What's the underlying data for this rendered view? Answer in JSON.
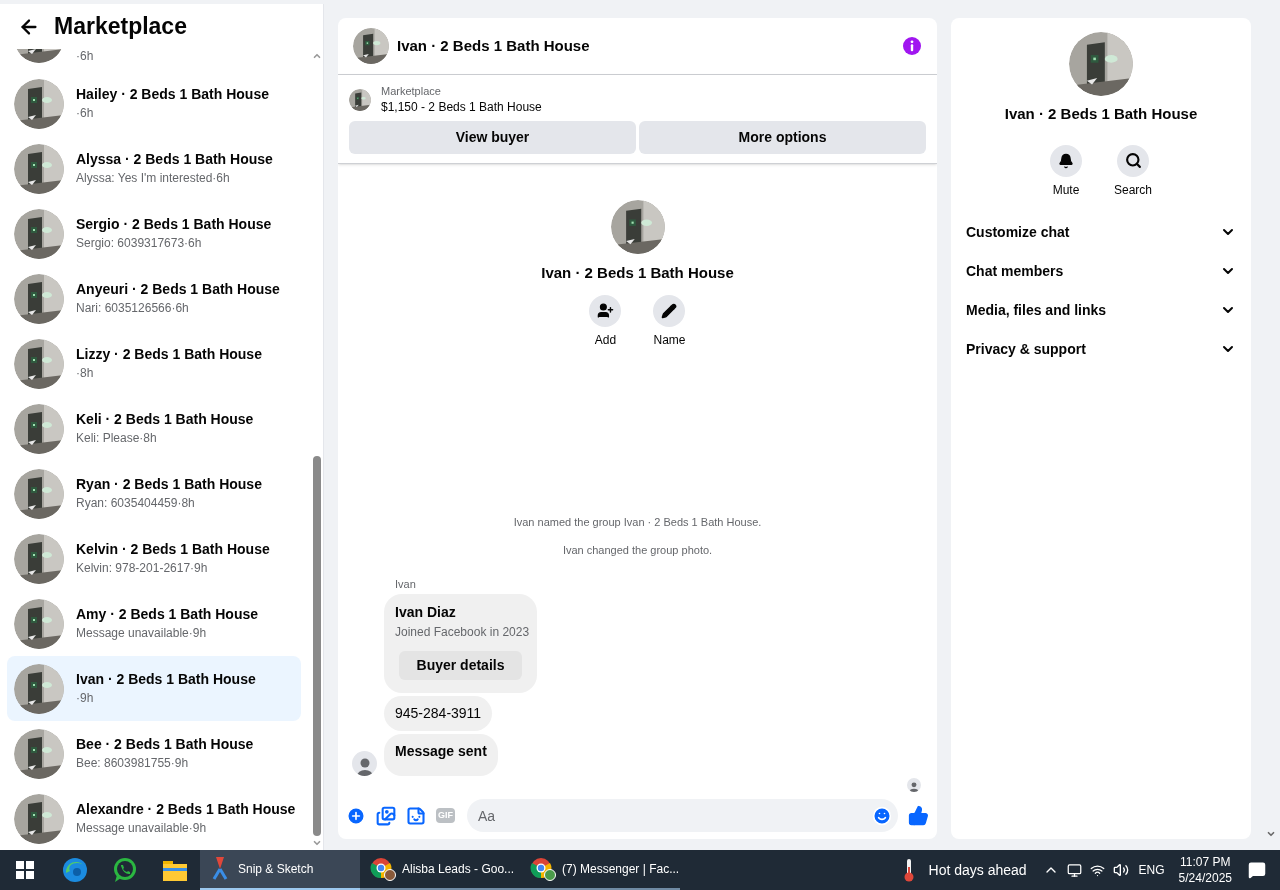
{
  "sidebar": {
    "title": "Marketplace",
    "partial_item": {
      "subtitle": "·6h"
    },
    "items": [
      {
        "title": "Hailey · 2 Beds 1 Bath House",
        "subtitle": "·6h",
        "selected": false
      },
      {
        "title": "Alyssa · 2 Beds 1 Bath House",
        "subtitle": "Alyssa: Yes I'm interested·6h",
        "selected": false
      },
      {
        "title": "Sergio · 2 Beds 1 Bath House",
        "subtitle": "Sergio: 6039317673·6h",
        "selected": false
      },
      {
        "title": "Anyeuri · 2 Beds 1 Bath House",
        "subtitle": "Nari: 6035126566·6h",
        "selected": false
      },
      {
        "title": "Lizzy · 2 Beds 1 Bath House",
        "subtitle": "·8h",
        "selected": false
      },
      {
        "title": "Keli · 2 Beds 1 Bath House",
        "subtitle": "Keli: Please·8h",
        "selected": false
      },
      {
        "title": "Ryan · 2 Beds 1 Bath House",
        "subtitle": "Ryan: 6035404459·8h",
        "selected": false
      },
      {
        "title": "Kelvin · 2 Beds 1 Bath House",
        "subtitle": "Kelvin: 978-201-2617·9h",
        "selected": false
      },
      {
        "title": "Amy · 2 Beds 1 Bath House",
        "subtitle": "Message unavailable·9h",
        "selected": false
      },
      {
        "title": "Ivan · 2 Beds 1 Bath House",
        "subtitle": "·9h",
        "selected": true
      },
      {
        "title": "Bee · 2 Beds 1 Bath House",
        "subtitle": "Bee: 8603981755·9h",
        "selected": false
      },
      {
        "title": "Alexandre · 2 Beds 1 Bath House",
        "subtitle": "Message unavailable·9h",
        "selected": false
      }
    ]
  },
  "chat": {
    "title": "Ivan · 2 Beds 1 Bath House",
    "listing": {
      "source": "Marketplace",
      "title": "$1,150 - 2 Beds 1 Bath House"
    },
    "buttons": [
      "View buyer",
      "More options"
    ],
    "intro": {
      "title": "Ivan · 2 Beds 1 Bath House",
      "actions": [
        {
          "kind": "add",
          "label": "Add"
        },
        {
          "kind": "name",
          "label": "Name"
        }
      ]
    },
    "events": [
      "Ivan named the group Ivan · 2 Beds 1 Bath House.",
      "Ivan changed the group photo."
    ],
    "sender": "Ivan",
    "card": {
      "name": "Ivan Diaz",
      "info": "Joined Facebook in 2023",
      "button": "Buyer details"
    },
    "messages": [
      {
        "text": "945-284-3911",
        "bold": false
      },
      {
        "text": "Message sent",
        "bold": true
      }
    ],
    "composer": {
      "gif_label": "GIF",
      "placeholder": "Aa"
    }
  },
  "details": {
    "title": "Ivan · 2 Beds 1 Bath House",
    "actions": [
      {
        "kind": "mute",
        "label": "Mute"
      },
      {
        "kind": "search",
        "label": "Search"
      }
    ],
    "sections": [
      {
        "label": "Customize chat",
        "expanded": false
      },
      {
        "label": "Chat members",
        "expanded": false
      },
      {
        "label": "Media, files and links",
        "expanded": false
      },
      {
        "label": "Privacy & support",
        "expanded": false
      }
    ]
  },
  "taskbar": {
    "apps": [
      {
        "kind": "windows"
      },
      {
        "kind": "edge"
      },
      {
        "kind": "whatsapp"
      },
      {
        "kind": "files"
      }
    ],
    "tasks": [
      {
        "kind": "snip",
        "label": "Snip & Sketch",
        "selected": true
      },
      {
        "kind": "chrome",
        "label": "Alisba Leads - Goo...",
        "selected": false
      },
      {
        "kind": "chrome2",
        "label": "(7) Messenger | Fac...",
        "selected": false
      }
    ],
    "weather": "Hot days ahead",
    "language": "ENG",
    "time": "11:07 PM",
    "date": "5/24/2025"
  }
}
